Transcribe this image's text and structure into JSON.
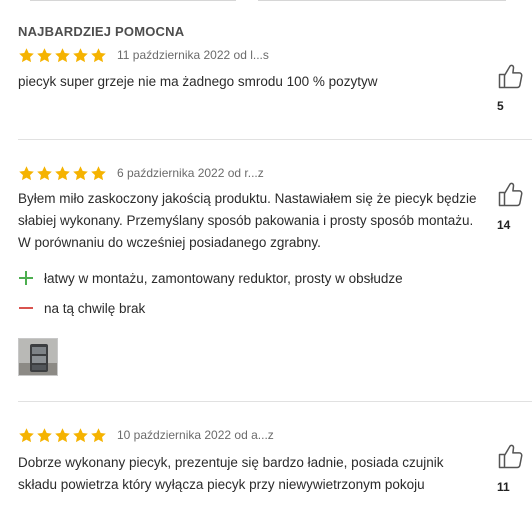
{
  "colors": {
    "star": "#f5b301",
    "pro": "#4cae4f",
    "con": "#d9534f",
    "divider": "#e1e1e1"
  },
  "reviews": [
    {
      "section_label": "NAJBARDZIEJ POMOCNA",
      "rating": 5,
      "meta": "11 października 2022 od l...s",
      "text": "piecyk super grzeje nie ma żadnego smrodu 100 % pozytyw",
      "helpful_icon": "thumbs-up-icon",
      "helpful_count": "5"
    },
    {
      "rating": 5,
      "meta": "6 października 2022 od r...z",
      "text": "Byłem miło zaskoczony jakością produktu. Nastawiałem się że piecyk będzie słabiej wykonany. Przemyślany sposób pakowania i prosty sposób montażu. W porównaniu do wcześniej posiadanego zgrabny.",
      "pros": "łatwy w montażu, zamontowany reduktor, prosty w obsłudze",
      "cons": "na tą chwilę brak",
      "photo_icon": "heater-photo-thumbnail",
      "helpful_icon": "thumbs-up-icon",
      "helpful_count": "14"
    },
    {
      "rating": 5,
      "meta": "10 października 2022 od a...z",
      "text": "Dobrze wykonany piecyk, prezentuje się bardzo ładnie, posiada czujnik składu powietrza który wyłącza piecyk przy niewywietrzonym pokoju",
      "helpful_icon": "thumbs-up-icon",
      "helpful_count": "11"
    }
  ]
}
